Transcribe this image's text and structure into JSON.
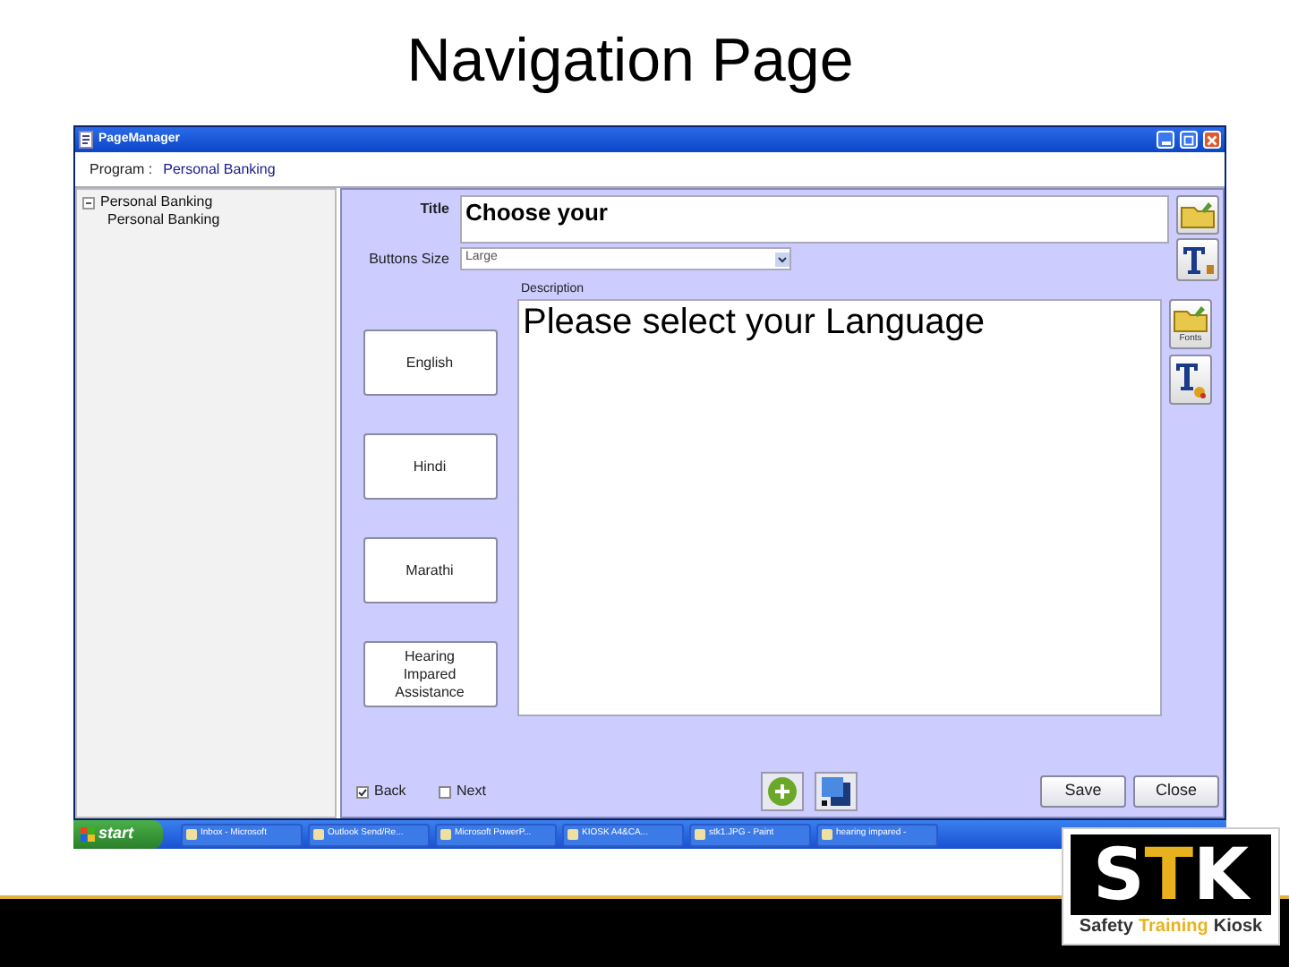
{
  "slide_title": "Navigation Page",
  "window": {
    "title": "PageManager"
  },
  "program": {
    "label": "Program :",
    "value": "Personal Banking"
  },
  "tree": [
    {
      "label": "Personal Banking",
      "expanded": true,
      "children": [
        {
          "label": "Personal Banking"
        }
      ]
    }
  ],
  "form": {
    "title_label": "Title",
    "title_value": "Choose your",
    "buttons_size_label": "Buttons Size",
    "buttons_size_value": "Large",
    "description_label": "Description",
    "description_value": "Please select your Language",
    "fonts_caption": "Fonts"
  },
  "language_buttons": [
    "English",
    "Hindi",
    "Marathi",
    "Hearing Impared Assistance"
  ],
  "nav_checks": [
    {
      "label": "Back",
      "checked": true
    },
    {
      "label": "Next",
      "checked": false
    }
  ],
  "actions": [
    "Save",
    "Close"
  ],
  "taskbar": {
    "start": "start",
    "items": [
      "Inbox - Microsoft",
      "Outlook Send/Re...",
      "Microsoft PowerP...",
      "KIOSK A4&CA...",
      "stk1.JPG - Paint",
      "hearing impared -"
    ]
  },
  "logo": {
    "letters": [
      {
        "text": "S",
        "color": "#ffffff"
      },
      {
        "text": "T",
        "color": "#e8b21e"
      },
      {
        "text": "K",
        "color": "#ffffff"
      }
    ],
    "tagline": [
      {
        "text": "Safety",
        "color": "#333333"
      },
      {
        "text": "Training",
        "color": "#e8b21e"
      },
      {
        "text": "Kiosk",
        "color": "#333333"
      }
    ]
  }
}
